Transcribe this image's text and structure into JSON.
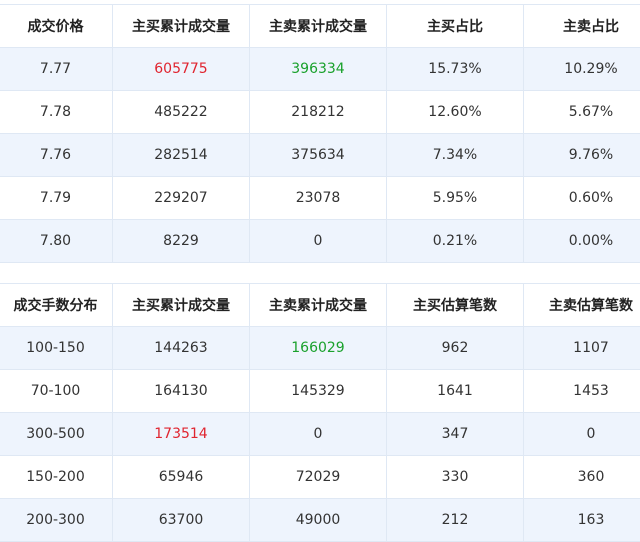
{
  "price_table": {
    "headers": [
      "成交价格",
      "主买累计成交量",
      "主卖累计成交量",
      "主买占比",
      "主卖占比"
    ],
    "rows": [
      [
        "7.77",
        "605775",
        "396334",
        "15.73%",
        "10.29%"
      ],
      [
        "7.78",
        "485222",
        "218212",
        "12.60%",
        "5.67%"
      ],
      [
        "7.76",
        "282514",
        "375634",
        "7.34%",
        "9.76%"
      ],
      [
        "7.79",
        "229207",
        "23078",
        "5.95%",
        "0.60%"
      ],
      [
        "7.80",
        "8229",
        "0",
        "0.21%",
        "0.00%"
      ]
    ]
  },
  "lot_table": {
    "headers": [
      "成交手数分布",
      "主买累计成交量",
      "主卖累计成交量",
      "主买估算笔数",
      "主卖估算笔数"
    ],
    "rows": [
      [
        "100-150",
        "144263",
        "166029",
        "962",
        "1107"
      ],
      [
        "70-100",
        "164130",
        "145329",
        "1641",
        "1453"
      ],
      [
        "300-500",
        "173514",
        "0",
        "347",
        "0"
      ],
      [
        "150-200",
        "65946",
        "72029",
        "330",
        "360"
      ],
      [
        "200-300",
        "63700",
        "49000",
        "212",
        "163"
      ]
    ]
  },
  "colors": {
    "highlight_max_buy": "#e0242f",
    "highlight_max_sell": "#1aa12c",
    "row_stripe": "#eef4fd",
    "border": "#dfe8f4"
  }
}
